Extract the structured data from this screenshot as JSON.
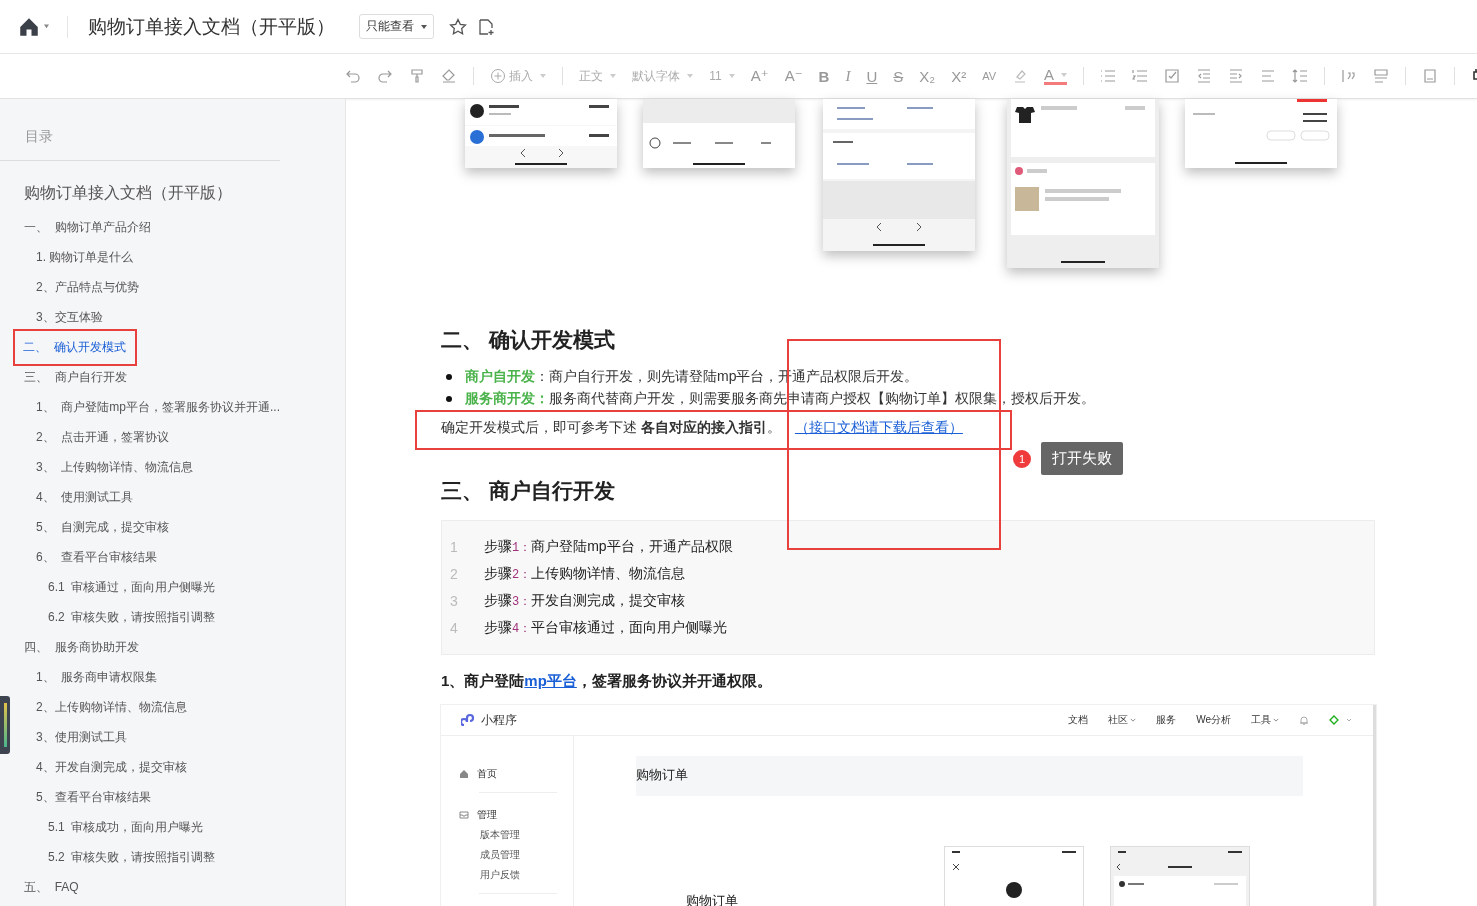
{
  "header": {
    "title": "购物订单接入文档（开平版）",
    "permission": "只能查看"
  },
  "toolbar": [
    {
      "kind": "undo"
    },
    {
      "kind": "redo"
    },
    {
      "kind": "paint"
    },
    {
      "kind": "erase"
    },
    {
      "kind": "sep"
    },
    {
      "kind": "insert",
      "label": "插入"
    },
    {
      "kind": "sep"
    },
    {
      "kind": "drop",
      "label": "正文"
    },
    {
      "kind": "drop",
      "label": "默认字体"
    },
    {
      "kind": "drop",
      "label": "11"
    },
    {
      "kind": "letter",
      "label": "A⁺"
    },
    {
      "kind": "letter",
      "label": "A⁻"
    },
    {
      "kind": "bold",
      "label": "B"
    },
    {
      "kind": "italic",
      "label": "I"
    },
    {
      "kind": "underline",
      "label": "U"
    },
    {
      "kind": "strike",
      "label": "S"
    },
    {
      "kind": "letter",
      "label": "X₂"
    },
    {
      "kind": "letter",
      "label": "X²"
    },
    {
      "kind": "spacing",
      "label": "AV"
    },
    {
      "kind": "highlight"
    },
    {
      "kind": "color",
      "label": "A"
    },
    {
      "kind": "sep"
    },
    {
      "kind": "bullets"
    },
    {
      "kind": "numbers"
    },
    {
      "kind": "todo"
    },
    {
      "kind": "outdent"
    },
    {
      "kind": "indent"
    },
    {
      "kind": "align"
    },
    {
      "kind": "lineheight"
    },
    {
      "kind": "sep"
    },
    {
      "kind": "quote"
    },
    {
      "kind": "block"
    },
    {
      "kind": "sep"
    },
    {
      "kind": "template"
    },
    {
      "kind": "sep"
    },
    {
      "kind": "device"
    }
  ],
  "toc": {
    "heading": "目录",
    "title": "购物订单接入文档（开平版）",
    "items": [
      {
        "label": "一、  购物订单产品介绍",
        "selected": false,
        "children": [
          {
            "label": "1. 购物订单是什么",
            "selected": false
          },
          {
            "label": "2、产品特点与优势",
            "selected": false
          },
          {
            "label": "3、交互体验",
            "selected": false
          }
        ]
      },
      {
        "label": "二、  确认开发模式",
        "selected": true
      },
      {
        "label": "三、  商户自行开发",
        "selected": false,
        "children": [
          {
            "label": "1、  商户登陆mp平台，签署服务协议并开通...",
            "selected": false
          },
          {
            "label": "2、  点击开通，签署协议",
            "selected": false
          },
          {
            "label": "3、  上传购物详情、物流信息",
            "selected": false
          },
          {
            "label": "4、  使用测试工具",
            "selected": false
          },
          {
            "label": "5、  自测完成，提交审核",
            "selected": false
          },
          {
            "label": "6、  查看平台审核结果",
            "selected": false,
            "children": [
              {
                "label": "6.1  审核通过，面向用户侧曝光",
                "selected": false
              },
              {
                "label": "6.2  审核失败，请按照指引调整",
                "selected": false
              }
            ]
          }
        ]
      },
      {
        "label": "四、  服务商协助开发",
        "selected": false,
        "children": [
          {
            "label": "1、  服务商申请权限集",
            "selected": false
          },
          {
            "label": "2、上传购物详情、物流信息",
            "selected": false
          },
          {
            "label": "3、使用测试工具",
            "selected": false
          },
          {
            "label": "4、开发自测完成，提交审核",
            "selected": false
          },
          {
            "label": "5、查看平台审核结果",
            "selected": false,
            "children": [
              {
                "label": "5.1  审核成功，面向用户曝光",
                "selected": false
              },
              {
                "label": "5.2  审核失败，请按照指引调整",
                "selected": false
              }
            ]
          }
        ]
      },
      {
        "label": "五、  FAQ",
        "selected": false
      }
    ]
  },
  "phones": [
    {
      "kind": "bill"
    },
    {
      "kind": "tabs"
    },
    {
      "kind": "service"
    },
    {
      "kind": "orders"
    },
    {
      "kind": "delivery"
    }
  ],
  "section2": {
    "heading": "二、 确认开发模式",
    "bullets": [
      {
        "lead": "商户自开发",
        "text": "：商户自行开发，则先请登陆mp平台，开通产品权限后开发。"
      },
      {
        "lead": "服务商开发：",
        "text": "服务商代替商户开发，则需要服务商先申请商户授权【购物订单】权限集，授权后开发。"
      }
    ],
    "paragraph": "确定开发模式后，即可参考下述 **各自对应的接入指引**。",
    "link": "（接口文档请下载后查看）"
  },
  "error": {
    "badge": "1",
    "tooltip": "打开失败"
  },
  "section3": {
    "heading": "三、 商户自行开发",
    "steps": [
      {
        "line": "1",
        "label": "步骤",
        "num": "1：",
        "text": "商户登陆mp平台，开通产品权限"
      },
      {
        "line": "2",
        "label": "步骤",
        "num": "2：",
        "text": "上传购物详情、物流信息"
      },
      {
        "line": "3",
        "label": "步骤",
        "num": "3：",
        "text": "开发自测完成，提交审核"
      },
      {
        "line": "4",
        "label": "步骤",
        "num": "4：",
        "text": "平台审核通过，面向用户侧曝光"
      }
    ]
  },
  "subheading": {
    "before": "1、商户登陆",
    "link": "mp平台",
    "after": "，签署服务协议并开通权限。"
  },
  "embedded": {
    "brand": "小程序",
    "nav": [
      {
        "label": "文档",
        "dropdown": false
      },
      {
        "label": "社区",
        "dropdown": true
      },
      {
        "label": "服务",
        "dropdown": false
      },
      {
        "label": "We分析",
        "dropdown": false
      },
      {
        "label": "工具",
        "dropdown": true
      }
    ],
    "menu": [
      {
        "label": "首页",
        "kind": "home"
      },
      {
        "label": "管理",
        "kind": "manage",
        "children": [
          "版本管理",
          "成员管理",
          "用户反馈"
        ]
      }
    ],
    "page_title": "购物订单",
    "card_title": "购物订单"
  }
}
